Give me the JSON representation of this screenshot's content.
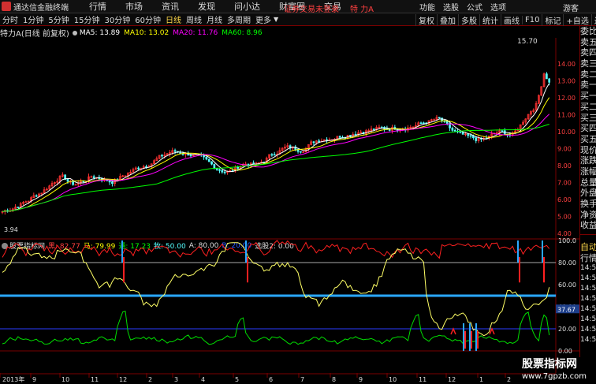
{
  "app": {
    "title": "通达信金融终端",
    "login_status": "证券交易未登录",
    "stock": "特 力A",
    "guest": "游客"
  },
  "menu": [
    "行情",
    "市场",
    "资讯",
    "发现",
    "问小达",
    "财富圈",
    "交易"
  ],
  "right_menu": [
    "功能",
    "选股",
    "公式",
    "选项"
  ],
  "periods": [
    "分时",
    "1分钟",
    "5分钟",
    "15分钟",
    "30分钟",
    "60分钟",
    "日线",
    "周线",
    "月线",
    "多周期",
    "更多"
  ],
  "active_period": "日线",
  "toolbar": [
    "复权",
    "叠加",
    "多股",
    "统计",
    "画线",
    "F10",
    "标记",
    "+自选",
    "返回"
  ],
  "main_legend": {
    "name": "特力A(日线 前复权)",
    "ma5": "MA5: 13.89",
    "ma10": "MA10: 13.02",
    "ma20": "MA20: 11.76",
    "ma60": "MA60: 8.96"
  },
  "sub_legend": {
    "name": "股票指标网",
    "l1": "黑: 82.77",
    "l2": "马: 79.99",
    "l3": "通: 17.23",
    "l4": "牧: 50.00",
    "l5": "A: 80.00",
    "l6": "B: 20.00",
    "l7": "选股2: 0.00"
  },
  "price_axis": [
    "14.00",
    "13.00",
    "12.00",
    "11.00",
    "10.00",
    "9.00",
    "8.00",
    "7.00",
    "6.00",
    "5.00",
    "4.00"
  ],
  "high_label": "15.70",
  "low_label": "3.94",
  "indicator_axis": [
    "100.0",
    "80.00",
    "60.00",
    "40.00",
    "20.00",
    "0.00"
  ],
  "current_tag": "37.67",
  "date_axis": [
    "2013年",
    "9",
    "10",
    "11",
    "12",
    "2",
    "3",
    "4",
    "5",
    "6",
    "7",
    "8",
    "9",
    "10",
    "11",
    "12",
    "1",
    "2"
  ],
  "side_panel": [
    "委比",
    "卖五",
    "卖四",
    "卖三",
    "卖二",
    "卖一",
    "买一",
    "买二",
    "买三",
    "买四",
    "买五",
    "现价",
    "涨跌",
    "涨幅",
    "总量",
    "外盘",
    "换手",
    "净资",
    "收益"
  ],
  "side_bottom": [
    "自动",
    "行情"
  ],
  "side_times": [
    "14:56",
    "14:56",
    "14:56",
    "14:56",
    "14:56",
    "14:56",
    "14:56",
    "14:56",
    "14:56",
    "14:56"
  ],
  "watermark": {
    "main": "股票指标网",
    "url": "www.7gpzb.com"
  },
  "colors": {
    "up": "#ff3232",
    "down": "#54ffff",
    "ma5": "#ffffff",
    "ma10": "#ffff00",
    "ma20": "#ff00ff",
    "ma60": "#00ff00",
    "accent": "#ff4040"
  }
}
